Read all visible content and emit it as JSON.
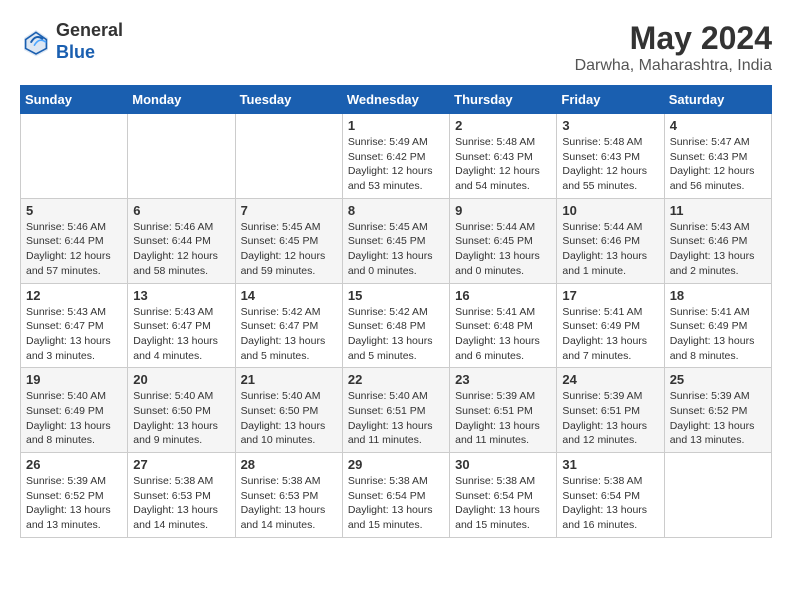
{
  "header": {
    "logo_line1": "General",
    "logo_line2": "Blue",
    "month_title": "May 2024",
    "location": "Darwha, Maharashtra, India"
  },
  "days_of_week": [
    "Sunday",
    "Monday",
    "Tuesday",
    "Wednesday",
    "Thursday",
    "Friday",
    "Saturday"
  ],
  "weeks": [
    [
      {
        "day": "",
        "info": ""
      },
      {
        "day": "",
        "info": ""
      },
      {
        "day": "",
        "info": ""
      },
      {
        "day": "1",
        "info": "Sunrise: 5:49 AM\nSunset: 6:42 PM\nDaylight: 12 hours\nand 53 minutes."
      },
      {
        "day": "2",
        "info": "Sunrise: 5:48 AM\nSunset: 6:43 PM\nDaylight: 12 hours\nand 54 minutes."
      },
      {
        "day": "3",
        "info": "Sunrise: 5:48 AM\nSunset: 6:43 PM\nDaylight: 12 hours\nand 55 minutes."
      },
      {
        "day": "4",
        "info": "Sunrise: 5:47 AM\nSunset: 6:43 PM\nDaylight: 12 hours\nand 56 minutes."
      }
    ],
    [
      {
        "day": "5",
        "info": "Sunrise: 5:46 AM\nSunset: 6:44 PM\nDaylight: 12 hours\nand 57 minutes."
      },
      {
        "day": "6",
        "info": "Sunrise: 5:46 AM\nSunset: 6:44 PM\nDaylight: 12 hours\nand 58 minutes."
      },
      {
        "day": "7",
        "info": "Sunrise: 5:45 AM\nSunset: 6:45 PM\nDaylight: 12 hours\nand 59 minutes."
      },
      {
        "day": "8",
        "info": "Sunrise: 5:45 AM\nSunset: 6:45 PM\nDaylight: 13 hours\nand 0 minutes."
      },
      {
        "day": "9",
        "info": "Sunrise: 5:44 AM\nSunset: 6:45 PM\nDaylight: 13 hours\nand 0 minutes."
      },
      {
        "day": "10",
        "info": "Sunrise: 5:44 AM\nSunset: 6:46 PM\nDaylight: 13 hours\nand 1 minute."
      },
      {
        "day": "11",
        "info": "Sunrise: 5:43 AM\nSunset: 6:46 PM\nDaylight: 13 hours\nand 2 minutes."
      }
    ],
    [
      {
        "day": "12",
        "info": "Sunrise: 5:43 AM\nSunset: 6:47 PM\nDaylight: 13 hours\nand 3 minutes."
      },
      {
        "day": "13",
        "info": "Sunrise: 5:43 AM\nSunset: 6:47 PM\nDaylight: 13 hours\nand 4 minutes."
      },
      {
        "day": "14",
        "info": "Sunrise: 5:42 AM\nSunset: 6:47 PM\nDaylight: 13 hours\nand 5 minutes."
      },
      {
        "day": "15",
        "info": "Sunrise: 5:42 AM\nSunset: 6:48 PM\nDaylight: 13 hours\nand 5 minutes."
      },
      {
        "day": "16",
        "info": "Sunrise: 5:41 AM\nSunset: 6:48 PM\nDaylight: 13 hours\nand 6 minutes."
      },
      {
        "day": "17",
        "info": "Sunrise: 5:41 AM\nSunset: 6:49 PM\nDaylight: 13 hours\nand 7 minutes."
      },
      {
        "day": "18",
        "info": "Sunrise: 5:41 AM\nSunset: 6:49 PM\nDaylight: 13 hours\nand 8 minutes."
      }
    ],
    [
      {
        "day": "19",
        "info": "Sunrise: 5:40 AM\nSunset: 6:49 PM\nDaylight: 13 hours\nand 8 minutes."
      },
      {
        "day": "20",
        "info": "Sunrise: 5:40 AM\nSunset: 6:50 PM\nDaylight: 13 hours\nand 9 minutes."
      },
      {
        "day": "21",
        "info": "Sunrise: 5:40 AM\nSunset: 6:50 PM\nDaylight: 13 hours\nand 10 minutes."
      },
      {
        "day": "22",
        "info": "Sunrise: 5:40 AM\nSunset: 6:51 PM\nDaylight: 13 hours\nand 11 minutes."
      },
      {
        "day": "23",
        "info": "Sunrise: 5:39 AM\nSunset: 6:51 PM\nDaylight: 13 hours\nand 11 minutes."
      },
      {
        "day": "24",
        "info": "Sunrise: 5:39 AM\nSunset: 6:51 PM\nDaylight: 13 hours\nand 12 minutes."
      },
      {
        "day": "25",
        "info": "Sunrise: 5:39 AM\nSunset: 6:52 PM\nDaylight: 13 hours\nand 13 minutes."
      }
    ],
    [
      {
        "day": "26",
        "info": "Sunrise: 5:39 AM\nSunset: 6:52 PM\nDaylight: 13 hours\nand 13 minutes."
      },
      {
        "day": "27",
        "info": "Sunrise: 5:38 AM\nSunset: 6:53 PM\nDaylight: 13 hours\nand 14 minutes."
      },
      {
        "day": "28",
        "info": "Sunrise: 5:38 AM\nSunset: 6:53 PM\nDaylight: 13 hours\nand 14 minutes."
      },
      {
        "day": "29",
        "info": "Sunrise: 5:38 AM\nSunset: 6:54 PM\nDaylight: 13 hours\nand 15 minutes."
      },
      {
        "day": "30",
        "info": "Sunrise: 5:38 AM\nSunset: 6:54 PM\nDaylight: 13 hours\nand 15 minutes."
      },
      {
        "day": "31",
        "info": "Sunrise: 5:38 AM\nSunset: 6:54 PM\nDaylight: 13 hours\nand 16 minutes."
      },
      {
        "day": "",
        "info": ""
      }
    ]
  ]
}
